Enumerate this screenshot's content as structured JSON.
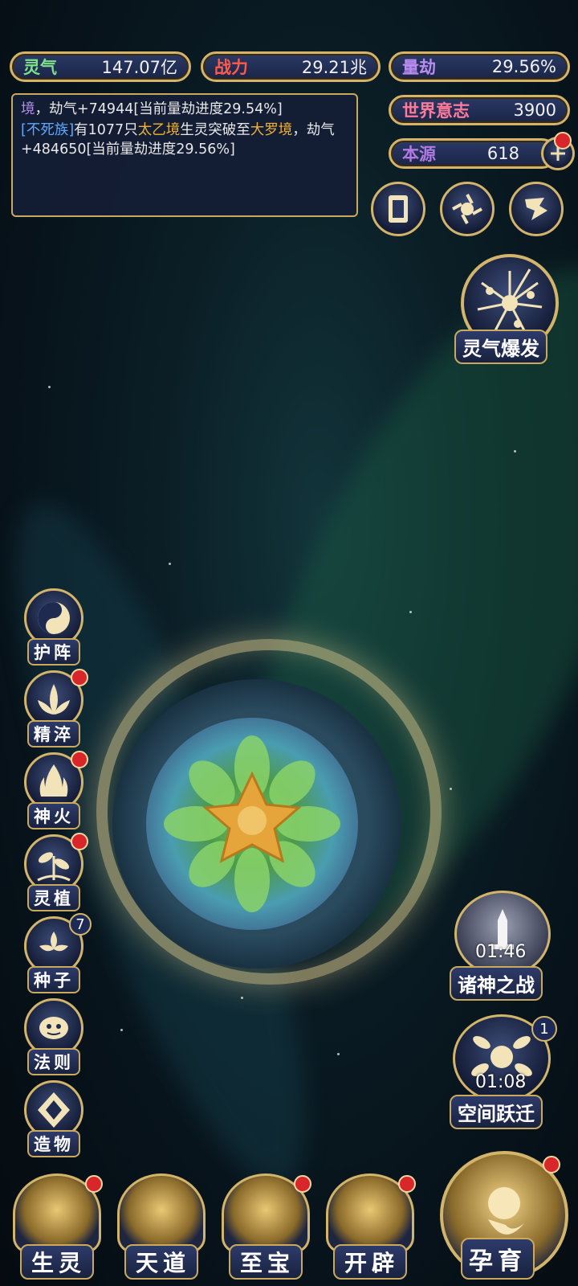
{
  "stats": {
    "lingqi": {
      "label": "灵气",
      "value": "147.07亿",
      "color": "#7fe08a"
    },
    "zhanli": {
      "label": "战力",
      "value": "29.21兆",
      "color": "#ff5a4a"
    },
    "liangjie": {
      "label": "量劫",
      "value": "29.56%",
      "color": "#b88cf0"
    },
    "world_will": {
      "label": "世界意志",
      "value": "3900",
      "color": "#ff7a9a"
    },
    "benyuan": {
      "label": "本源",
      "value": "618",
      "color": "#b07ae0"
    }
  },
  "log": {
    "line1_prefix": "境",
    "line1_text": "，劫气+74944[当前量劫进度29.54%]",
    "line2_open": "[",
    "line2_race": "不死族",
    "line2_close": "]",
    "line2_mid": "有1077只",
    "line2_realm1": "太乙境",
    "line2_mid2": "生灵突破至",
    "line2_realm2": "大罗境",
    "line2_end": "，劫气+484650[当前量劫进度29.56%]"
  },
  "top_icons": [
    "card-icon",
    "swirl-icon",
    "flag-icon"
  ],
  "burst": {
    "label": "灵气爆发"
  },
  "side_menu": [
    {
      "label": "护阵",
      "icon": "yin-yang-icon",
      "dot": false
    },
    {
      "label": "精淬",
      "icon": "lotus-icon",
      "dot": true
    },
    {
      "label": "神火",
      "icon": "flame-icon",
      "dot": true
    },
    {
      "label": "灵植",
      "icon": "plant-icon",
      "dot": true
    },
    {
      "label": "种子",
      "icon": "seed-icon",
      "badge": "7"
    },
    {
      "label": "法则",
      "icon": "rune-icon",
      "dot": false
    },
    {
      "label": "造物",
      "icon": "crystal-icon",
      "dot": false
    }
  ],
  "events": {
    "gods_war": {
      "label": "诸神之战",
      "timer": "01:46"
    },
    "space_jump": {
      "label": "空间跃迁",
      "timer": "01:08",
      "badge": "1"
    }
  },
  "bottom_nav": [
    {
      "label": "生灵",
      "dot": true
    },
    {
      "label": "天道",
      "dot": false
    },
    {
      "label": "至宝",
      "dot": true
    },
    {
      "label": "开辟",
      "dot": true
    }
  ],
  "incubate": {
    "label": "孕育"
  }
}
